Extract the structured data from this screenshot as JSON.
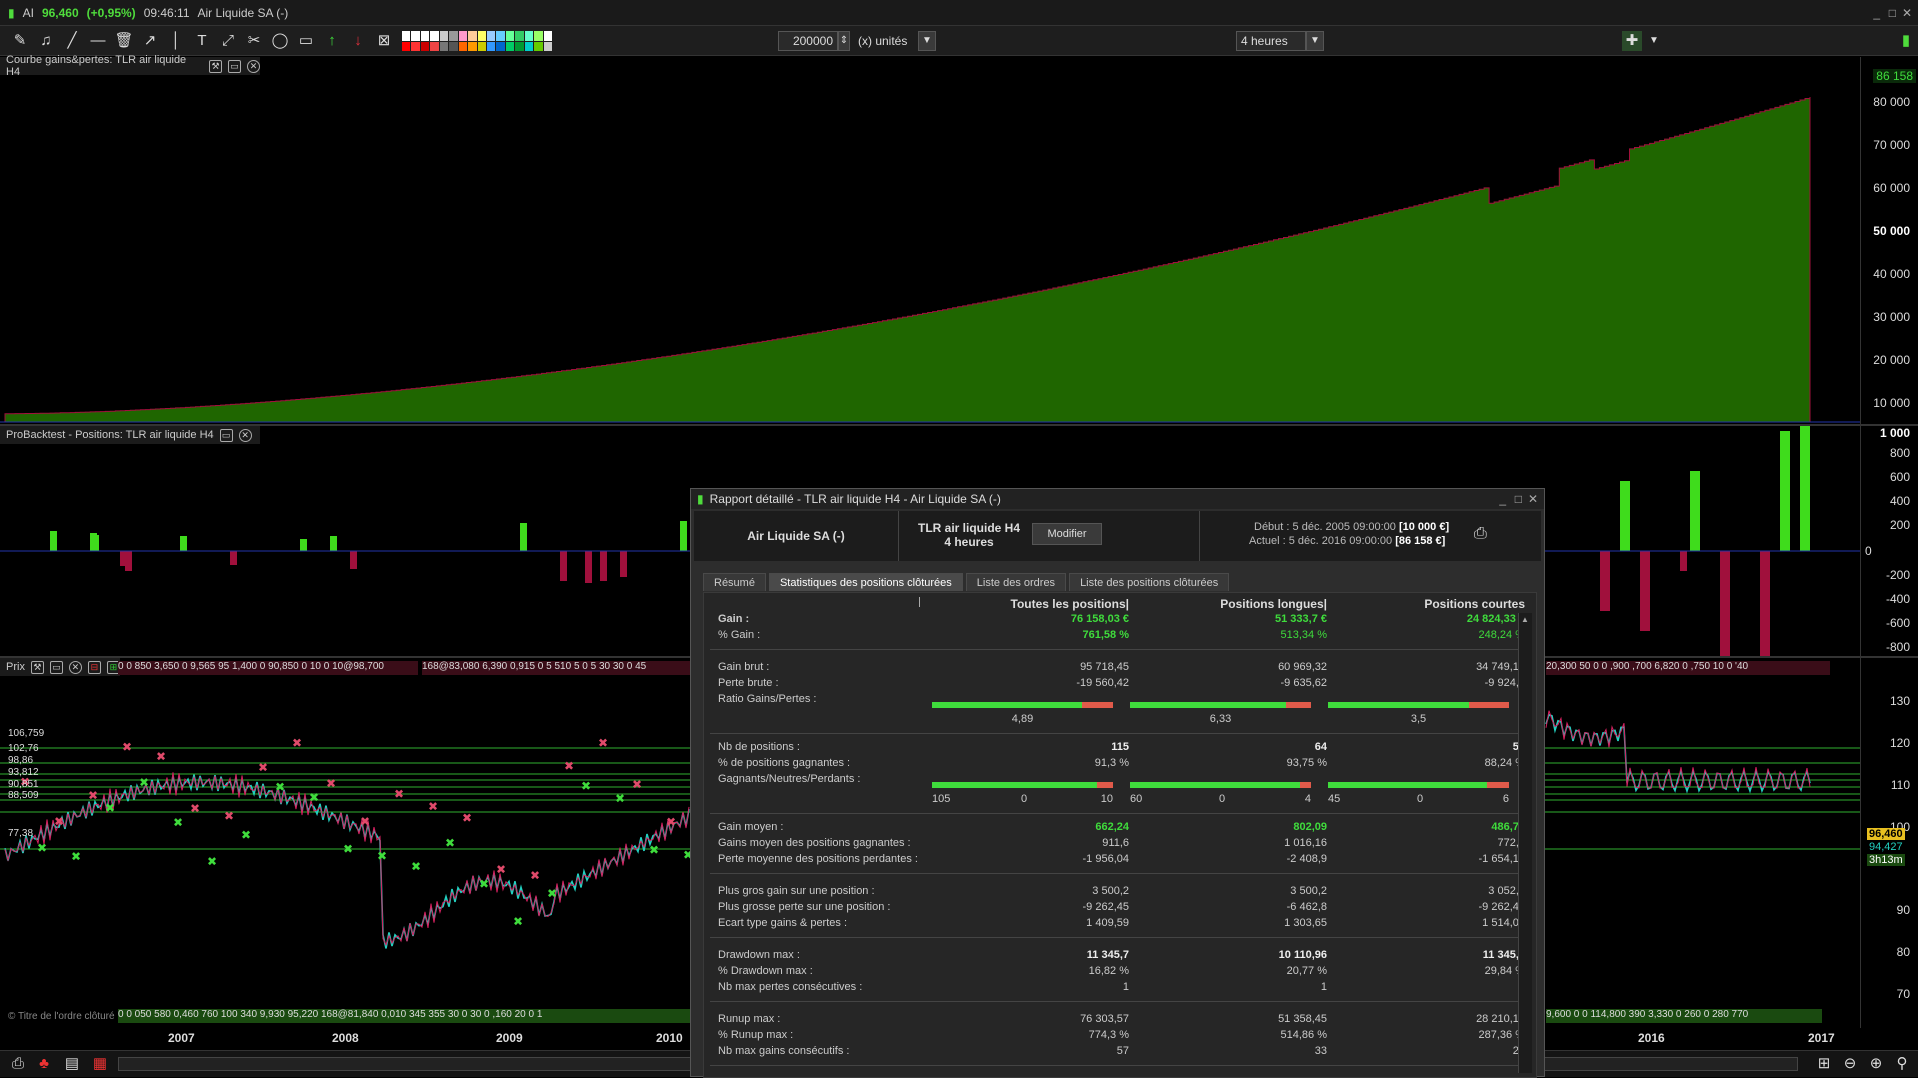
{
  "titlebar": {
    "app": "AI",
    "price": "96,460",
    "change": "(+0,95%)",
    "time": "09:46:11",
    "instrument": "Air Liquide SA (-)"
  },
  "toolbar": {
    "quantity": "200000",
    "unit_label": "(x) unités",
    "timeframe": "4 heures"
  },
  "equity_pane": {
    "title": "Courbe gains&pertes: TLR air liquide H4",
    "last_value": "86 158",
    "y_ticks": [
      "80 000",
      "70 000",
      "60 000",
      "50 000",
      "40 000",
      "30 000",
      "20 000",
      "10 000"
    ]
  },
  "positions_pane": {
    "title": "ProBacktest - Positions: TLR air liquide H4",
    "y_ticks": [
      "1 000",
      "800",
      "600",
      "400",
      "200",
      "0",
      "-200",
      "-400",
      "-600",
      "-800"
    ]
  },
  "price_pane": {
    "title": "Prix",
    "y_ticks": [
      "130",
      "120",
      "110",
      "100",
      "90",
      "80",
      "70",
      "60"
    ],
    "levels": [
      "106,759",
      "102,76",
      "98,86",
      "93,812",
      "90,851",
      "88,509",
      "77,38"
    ],
    "last_price": "96,460",
    "mid_price": "94,427",
    "countdown": "3h13m",
    "x_labels": [
      "2007",
      "2008",
      "2009",
      "2010",
      "2016",
      "2017"
    ],
    "top_strip": "0 0 850 3,650 0 9,565 95 1,400 0 90,850 0 10 0 10@98,700",
    "top_strip2": "168@83,080 6,390 0,915 0 5 510 5 0 5 30 30 0 45",
    "top_strip_right": "20,300 50 0 0 ,900 ,700 6,820 0 ,750 10 0 '40",
    "bottom_strip": "0 0 050 580 0,460 760 100 340 9,930 95,220 168@81,840 0,010 345 355 30 0 30 0 ,160 20 0 1",
    "bottom_strip_right": "9,600 0 0 114,800 390 3,330 0 260 0 280 770",
    "watermark": "© Titre de l'ordre clôturé"
  },
  "dialog": {
    "title": "Rapport détaillé - TLR air liquide H4 - Air Liquide SA (-)",
    "instrument": "Air Liquide SA (-)",
    "strategy": "TLR air liquide H4",
    "timeframe": "4 heures",
    "modify_button": "Modifier",
    "start_label": "Début :",
    "start_date": "5 déc. 2005 09:00:00",
    "start_value": "[10 000 €]",
    "current_label": "Actuel :",
    "current_date": "5 déc. 2016 09:00:00",
    "current_value": "[86 158 €]",
    "tabs": [
      "Résumé",
      "Statistiques des positions clôturées",
      "Liste des ordres",
      "Liste des positions clôturées"
    ],
    "col_headers": [
      "Toutes les positions|",
      "Positions longues|",
      "Positions courtes"
    ],
    "rows": {
      "gain": {
        "label": "Gain :",
        "all": "76 158,03 €",
        "long": "51 333,7 €",
        "short": "24 824,33 €"
      },
      "pct_gain": {
        "label": "% Gain :",
        "all": "761,58 %",
        "long": "513,34 %",
        "short": "248,24 %"
      },
      "gross_gain": {
        "label": "Gain brut :",
        "all": "95 718,45",
        "long": "60 969,32",
        "short": "34 749,13"
      },
      "gross_loss": {
        "label": "Perte brute :",
        "all": "-19 560,42",
        "long": "-9 635,62",
        "short": "-9 924,8"
      },
      "ratio": {
        "label": "Ratio Gains/Pertes :",
        "all": "4,89",
        "long": "6,33",
        "short": "3,5"
      },
      "nb_pos": {
        "label": "Nb de positions :",
        "all": "115",
        "long": "64",
        "short": "51"
      },
      "pct_win": {
        "label": "% de positions gagnantes :",
        "all": "91,3 %",
        "long": "93,75 %",
        "short": "88,24 %"
      },
      "gnp": {
        "label": "Gagnants/Neutres/Perdants :",
        "all": [
          "105",
          "0",
          "10"
        ],
        "long": [
          "60",
          "0",
          "4"
        ],
        "short": [
          "45",
          "0",
          "6"
        ]
      },
      "avg_gain": {
        "label": "Gain moyen :",
        "all": "662,24",
        "long": "802,09",
        "short": "486,75"
      },
      "avg_win": {
        "label": "Gains moyen des positions gagnantes :",
        "all": "911,6",
        "long": "1 016,16",
        "short": "772,2"
      },
      "avg_loss": {
        "label": "Perte moyenne des positions perdantes :",
        "all": "-1 956,04",
        "long": "-2 408,9",
        "short": "-1 654,13"
      },
      "max_win": {
        "label": "Plus gros gain sur une position :",
        "all": "3 500,2",
        "long": "3 500,2",
        "short": "3 052,5"
      },
      "max_loss": {
        "label": "Plus grosse perte sur une position :",
        "all": "-9 262,45",
        "long": "-6 462,8",
        "short": "-9 262,45"
      },
      "std": {
        "label": "Ecart type gains & pertes :",
        "all": "1 409,59",
        "long": "1 303,65",
        "short": "1 514,04"
      },
      "dd": {
        "label": "Drawdown max :",
        "all": "11 345,7",
        "long": "10 110,96",
        "short": "11 345,7"
      },
      "pct_dd": {
        "label": "% Drawdown max :",
        "all": "16,82 %",
        "long": "20,77 %",
        "short": "29,84 %"
      },
      "max_consec_loss": {
        "label": "Nb max pertes consécutives :",
        "all": "1",
        "long": "1",
        "short": "1"
      },
      "runup": {
        "label": "Runup max :",
        "all": "76 303,57",
        "long": "51 358,45",
        "short": "28 210,13"
      },
      "pct_runup": {
        "label": "% Runup max :",
        "all": "774,3 %",
        "long": "514,86 %",
        "short": "287,36 %"
      },
      "max_consec_win": {
        "label": "Nb max gains consécutifs :",
        "all": "57",
        "long": "33",
        "short": "28"
      }
    },
    "ratio_bars": [
      0.83,
      0.86,
      0.78
    ],
    "win_bars": [
      0.91,
      0.94,
      0.88
    ]
  },
  "colors": {
    "equity_fill": "#1f6600",
    "gain": "#3fdc3c",
    "loss": "#a0103c",
    "accent": "#4fdc3c"
  }
}
